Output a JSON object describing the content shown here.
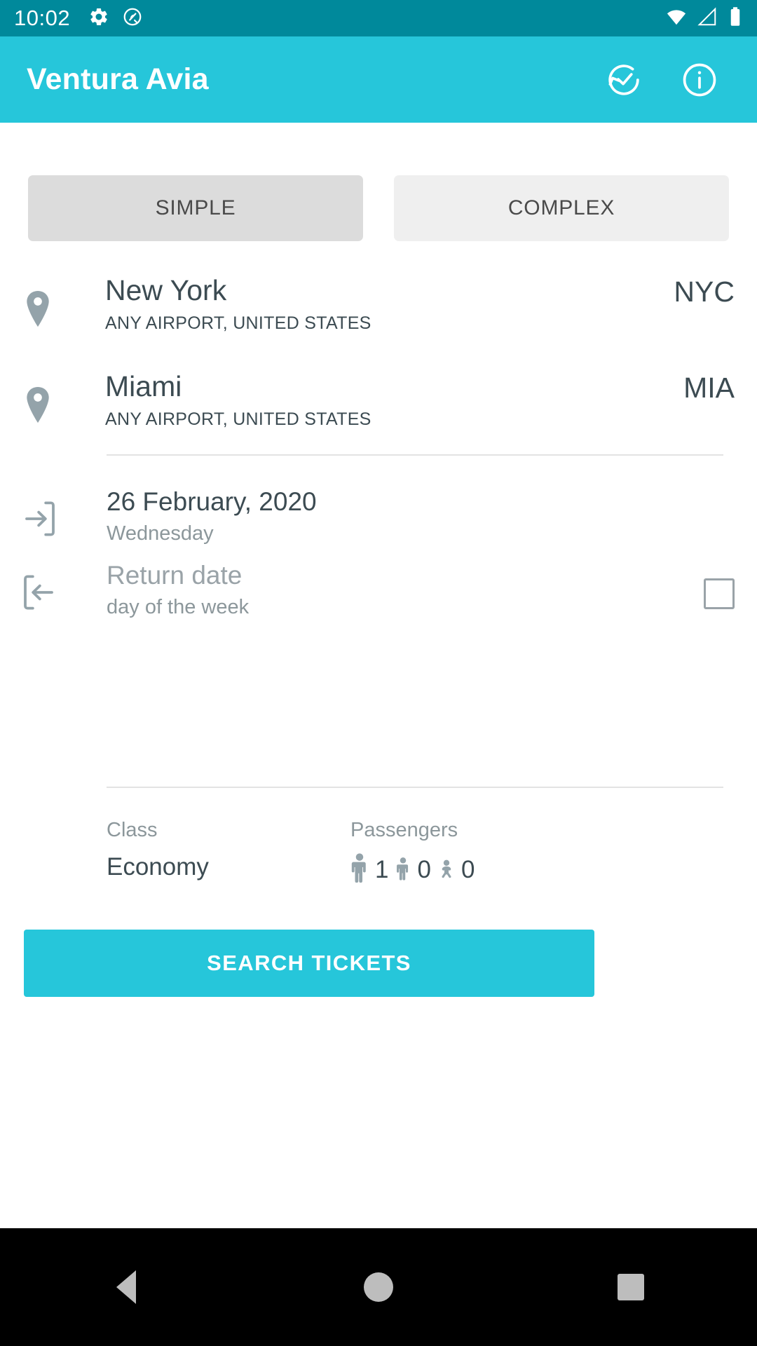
{
  "status_bar": {
    "time": "10:02",
    "icons": [
      "settings-gear-icon",
      "android-q-icon",
      "wifi-icon",
      "cellular-signal-icon",
      "battery-icon"
    ],
    "background_color": "#00899B"
  },
  "app_bar": {
    "title": "Ventura Avia",
    "background_color": "#26C6DA",
    "actions": [
      {
        "name": "history-icon"
      },
      {
        "name": "info-icon"
      }
    ]
  },
  "tabs": [
    {
      "label": "SIMPLE",
      "selected": true
    },
    {
      "label": "COMPLEX",
      "selected": false
    }
  ],
  "locations": [
    {
      "city": "New York",
      "subtitle": "ANY AIRPORT, UNITED STATES",
      "code": "NYC"
    },
    {
      "city": "Miami",
      "subtitle": "ANY AIRPORT, UNITED STATES",
      "code": "MIA"
    }
  ],
  "dates": {
    "departure": {
      "value": "26 February, 2020",
      "weekday": "Wednesday"
    },
    "return": {
      "placeholder": "Return date",
      "weekday_placeholder": "day of the week",
      "checkbox_checked": false
    }
  },
  "options": {
    "class_label": "Class",
    "class_value": "Economy",
    "passengers_label": "Passengers",
    "passengers": [
      {
        "type": "adult",
        "count": "1"
      },
      {
        "type": "child",
        "count": "0"
      },
      {
        "type": "infant",
        "count": "0"
      }
    ]
  },
  "search_button": {
    "label": "SEARCH TICKETS",
    "color": "#26C6DA"
  },
  "nav_bar": {
    "buttons": [
      "back-button",
      "home-button",
      "recents-button"
    ]
  },
  "colors": {
    "status_bar": "#00899B",
    "accent": "#26C6DA",
    "text_primary": "#3C4B52",
    "text_secondary": "#8C979B",
    "icon_gray": "#94A3AA"
  }
}
